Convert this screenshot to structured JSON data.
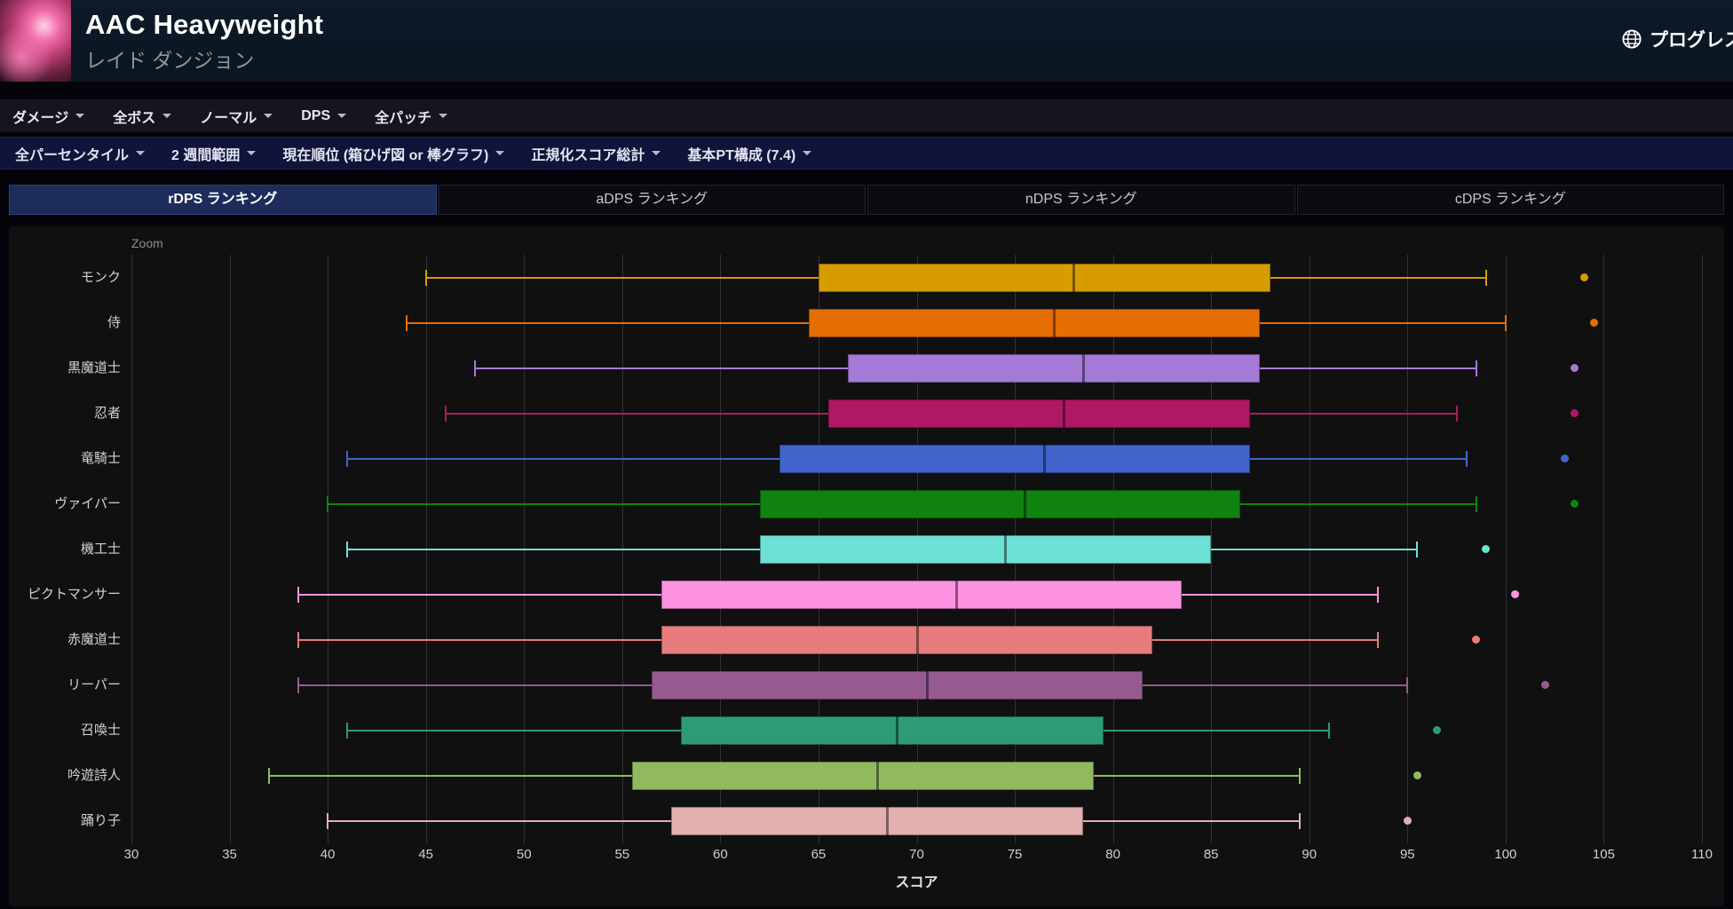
{
  "header": {
    "title": "AAC Heavyweight",
    "subtitle": "レイド ダンジョン",
    "right_link": "プログレス"
  },
  "menu": {
    "items": [
      "ダメージ",
      "全ボス",
      "ノーマル",
      "DPS",
      "全パッチ"
    ]
  },
  "filters": {
    "items": [
      "全パーセンタイル",
      "2 週間範囲",
      "現在順位 (箱ひげ図 or 棒グラフ)",
      "正規化スコア総計",
      "基本PT構成 (7.4)"
    ]
  },
  "tabs": [
    {
      "id": "rdps",
      "label": "rDPS ランキング",
      "active": true
    },
    {
      "id": "adps",
      "label": "aDPS ランキング",
      "active": false
    },
    {
      "id": "ndps",
      "label": "nDPS ランキング",
      "active": false
    },
    {
      "id": "cdps",
      "label": "cDPS ランキング",
      "active": false
    }
  ],
  "chart_data": {
    "type": "boxplot",
    "orientation": "horizontal",
    "zoom_label": "Zoom",
    "xlabel": "スコア",
    "xlim": [
      30,
      110
    ],
    "xticks": [
      30,
      35,
      40,
      45,
      50,
      55,
      60,
      65,
      70,
      75,
      80,
      85,
      90,
      95,
      100,
      105,
      110
    ],
    "grid": true,
    "series": [
      {
        "name": "モンク",
        "color": "#d69c00",
        "low": 45,
        "q1": 65,
        "median": 78,
        "q3": 88,
        "high": 99,
        "outliers": [
          104
        ]
      },
      {
        "name": "侍",
        "color": "#e46d04",
        "low": 44,
        "q1": 64.5,
        "median": 77,
        "q3": 87.5,
        "high": 100,
        "outliers": [
          104.5
        ]
      },
      {
        "name": "黒魔道士",
        "color": "#a579d6",
        "low": 47.5,
        "q1": 66.5,
        "median": 78.5,
        "q3": 87.5,
        "high": 98.5,
        "outliers": [
          103.5
        ]
      },
      {
        "name": "忍者",
        "color": "#af1964",
        "low": 46,
        "q1": 65.5,
        "median": 77.5,
        "q3": 87,
        "high": 97.5,
        "outliers": [
          103.5
        ]
      },
      {
        "name": "竜騎士",
        "color": "#4164cd",
        "low": 41,
        "q1": 63,
        "median": 76.5,
        "q3": 87,
        "high": 98,
        "outliers": [
          103
        ]
      },
      {
        "name": "ヴァイパー",
        "color": "#108210",
        "low": 40,
        "q1": 62,
        "median": 75.5,
        "q3": 86.5,
        "high": 98.5,
        "outliers": [
          103.5
        ]
      },
      {
        "name": "機工士",
        "color": "#6ee1d6",
        "low": 41,
        "q1": 62,
        "median": 74.5,
        "q3": 85,
        "high": 95.5,
        "outliers": [
          99
        ]
      },
      {
        "name": "ピクトマンサー",
        "color": "#fc92e1",
        "low": 38.5,
        "q1": 57,
        "median": 72,
        "q3": 83.5,
        "high": 93.5,
        "outliers": [
          100.5
        ]
      },
      {
        "name": "赤魔道士",
        "color": "#e87b7b",
        "low": 38.5,
        "q1": 57,
        "median": 70,
        "q3": 82,
        "high": 93.5,
        "outliers": [
          98.5
        ]
      },
      {
        "name": "リーパー",
        "color": "#965a90",
        "low": 38.5,
        "q1": 56.5,
        "median": 70.5,
        "q3": 81.5,
        "high": 95,
        "outliers": [
          102
        ]
      },
      {
        "name": "召喚士",
        "color": "#2d9b78",
        "low": 41,
        "q1": 58,
        "median": 69,
        "q3": 79.5,
        "high": 91,
        "outliers": [
          96.5
        ]
      },
      {
        "name": "吟遊詩人",
        "color": "#91ba5e",
        "low": 37,
        "q1": 55.5,
        "median": 68,
        "q3": 79,
        "high": 89.5,
        "outliers": [
          95.5
        ]
      },
      {
        "name": "踊り子",
        "color": "#e2b0af",
        "low": 40,
        "q1": 57.5,
        "median": 68.5,
        "q3": 78.5,
        "high": 89.5,
        "outliers": [
          95
        ]
      }
    ]
  }
}
